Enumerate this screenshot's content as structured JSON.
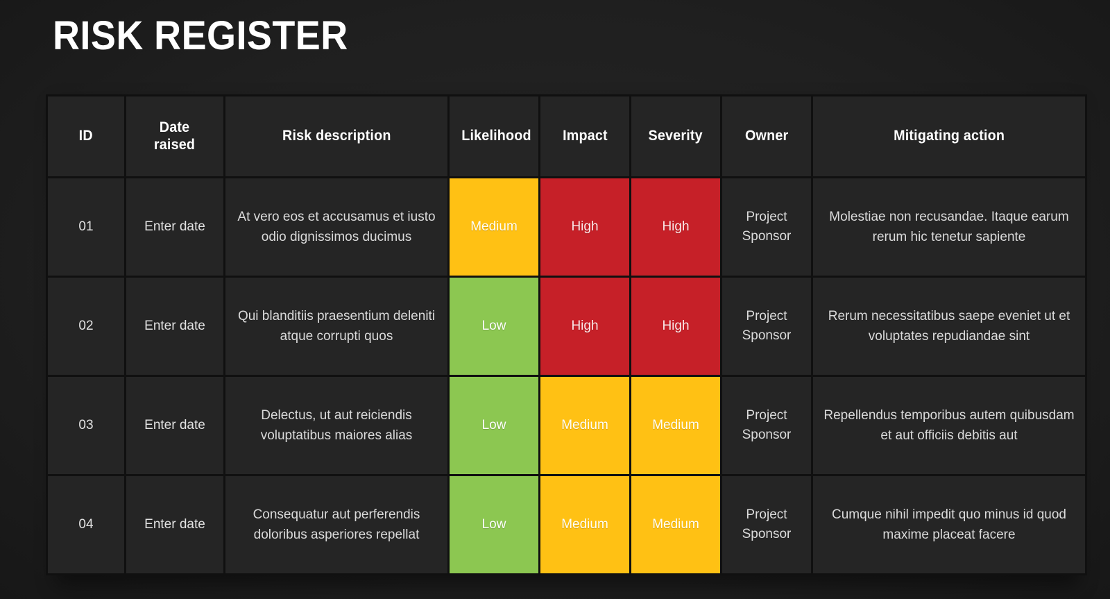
{
  "page": {
    "title": "RISK REGISTER",
    "background_color": "#1b1b1b"
  },
  "colors": {
    "low": "#8CC751",
    "medium": "#FFC114",
    "high": "#C62028",
    "cell": "#252525",
    "grid": "#101010",
    "text": "#dcdcdc",
    "title": "#ffffff"
  },
  "table": {
    "headers": {
      "id": "ID",
      "date_raised": "Date\nraised",
      "risk_description": "Risk description",
      "likelihood": "Likelihood",
      "impact": "Impact",
      "severity": "Severity",
      "owner": "Owner",
      "mitigating_action": "Mitigating action"
    },
    "rows": [
      {
        "id": "01",
        "date_raised": "Enter date",
        "risk_description": "At vero eos et accusamus et iusto odio dignissimos ducimus",
        "likelihood": "Medium",
        "likelihood_level": "medium",
        "impact": "High",
        "impact_level": "high",
        "severity": "High",
        "severity_level": "high",
        "owner": "Project\nSponsor",
        "mitigating_action": "Molestiae non recusandae. Itaque earum rerum hic tenetur sapiente"
      },
      {
        "id": "02",
        "date_raised": "Enter date",
        "risk_description": "Qui blanditiis praesentium deleniti atque corrupti quos",
        "likelihood": "Low",
        "likelihood_level": "low",
        "impact": "High",
        "impact_level": "high",
        "severity": "High",
        "severity_level": "high",
        "owner": "Project\nSponsor",
        "mitigating_action": "Rerum necessitatibus saepe eveniet ut et voluptates repudiandae sint"
      },
      {
        "id": "03",
        "date_raised": "Enter date",
        "risk_description": "Delectus, ut aut reiciendis voluptatibus maiores alias",
        "likelihood": "Low",
        "likelihood_level": "low",
        "impact": "Medium",
        "impact_level": "medium",
        "severity": "Medium",
        "severity_level": "medium",
        "owner": "Project\nSponsor",
        "mitigating_action": "Repellendus temporibus autem quibusdam et aut officiis debitis aut"
      },
      {
        "id": "04",
        "date_raised": "Enter date",
        "risk_description": "Consequatur aut perferendis doloribus asperiores repellat",
        "likelihood": "Low",
        "likelihood_level": "low",
        "impact": "Medium",
        "impact_level": "medium",
        "severity": "Medium",
        "severity_level": "medium",
        "owner": "Project\nSponsor",
        "mitigating_action": "Cumque nihil impedit quo minus id quod maxime placeat facere"
      }
    ]
  }
}
